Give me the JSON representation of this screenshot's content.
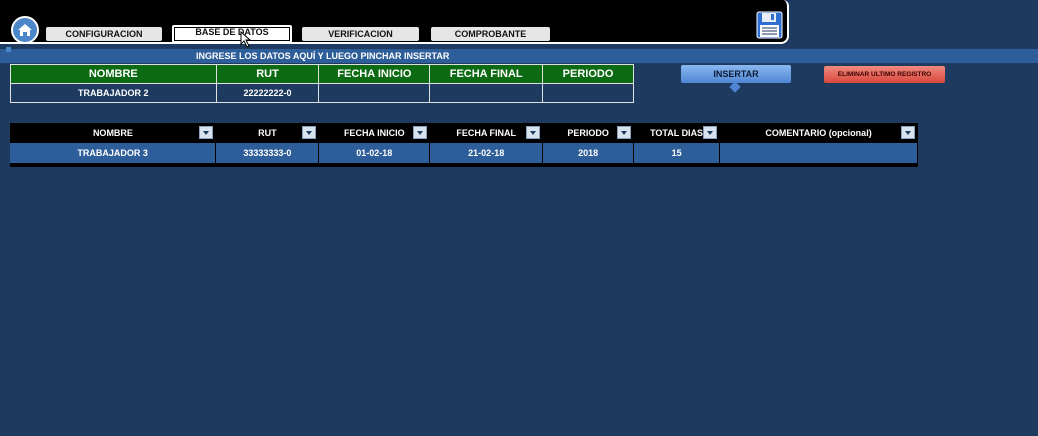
{
  "nav": {
    "buttons": [
      "CONFIGURACION",
      "BASE DE DATOS",
      "VERIFICACION",
      "COMPROBANTE"
    ],
    "active": "BASE DE DATOS"
  },
  "banner": "INGRESE LOS DATOS AQUÍ Y LUEGO PINCHAR INSERTAR",
  "entry_table": {
    "headers": [
      "NOMBRE",
      "RUT",
      "FECHA INICIO",
      "FECHA FINAL",
      "PERIODO"
    ],
    "row": [
      "TRABAJADOR 2",
      "22222222-0",
      "",
      "",
      ""
    ]
  },
  "actions": {
    "insert": "INSERTAR",
    "delete_last": "ELIMINAR ULTIMO REGISTRO"
  },
  "records_table": {
    "headers": [
      "NOMBRE",
      "RUT",
      "FECHA INICIO",
      "FECHA FINAL",
      "PERIODO",
      "TOTAL DIAS",
      "COMENTARIO (opcional)"
    ],
    "rows": [
      [
        "TRABAJADOR 3",
        "33333333-0",
        "01-02-18",
        "21-02-18",
        "2018",
        "15",
        ""
      ]
    ]
  },
  "colors": {
    "background": "#1f3a5f",
    "entry_header": "#0c6b12",
    "insert_button": "#4f86d4",
    "delete_button": "#d9473c"
  },
  "icons": [
    "home-icon",
    "save-icon",
    "cursor-icon",
    "dropdown-icon"
  ]
}
